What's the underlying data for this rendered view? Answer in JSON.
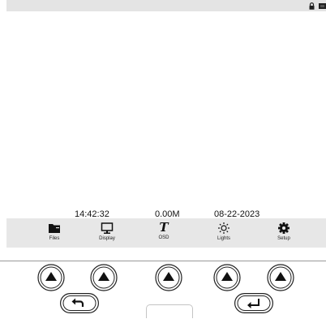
{
  "status_bar": {
    "time": "14:42:32",
    "storage": "0.00M",
    "date": "08-22-2023"
  },
  "menu": {
    "files": "Files",
    "display": "Display",
    "osd": "OSD",
    "osd_glyph": "T",
    "lights": "Lights",
    "setup": "Setup"
  },
  "icons": {
    "status": [
      "lock-icon",
      "battery-icon"
    ],
    "menu": [
      "folder-icon",
      "monitor-icon",
      "text-icon",
      "sun-icon",
      "gear-icon"
    ],
    "keypad": [
      "up-arrow-icon",
      "back-arrow-icon",
      "enter-arrow-icon"
    ]
  },
  "colors": {
    "topbar": "#e4e4e4",
    "menubar": "#e7e7e7",
    "button_fill": "#111111"
  }
}
